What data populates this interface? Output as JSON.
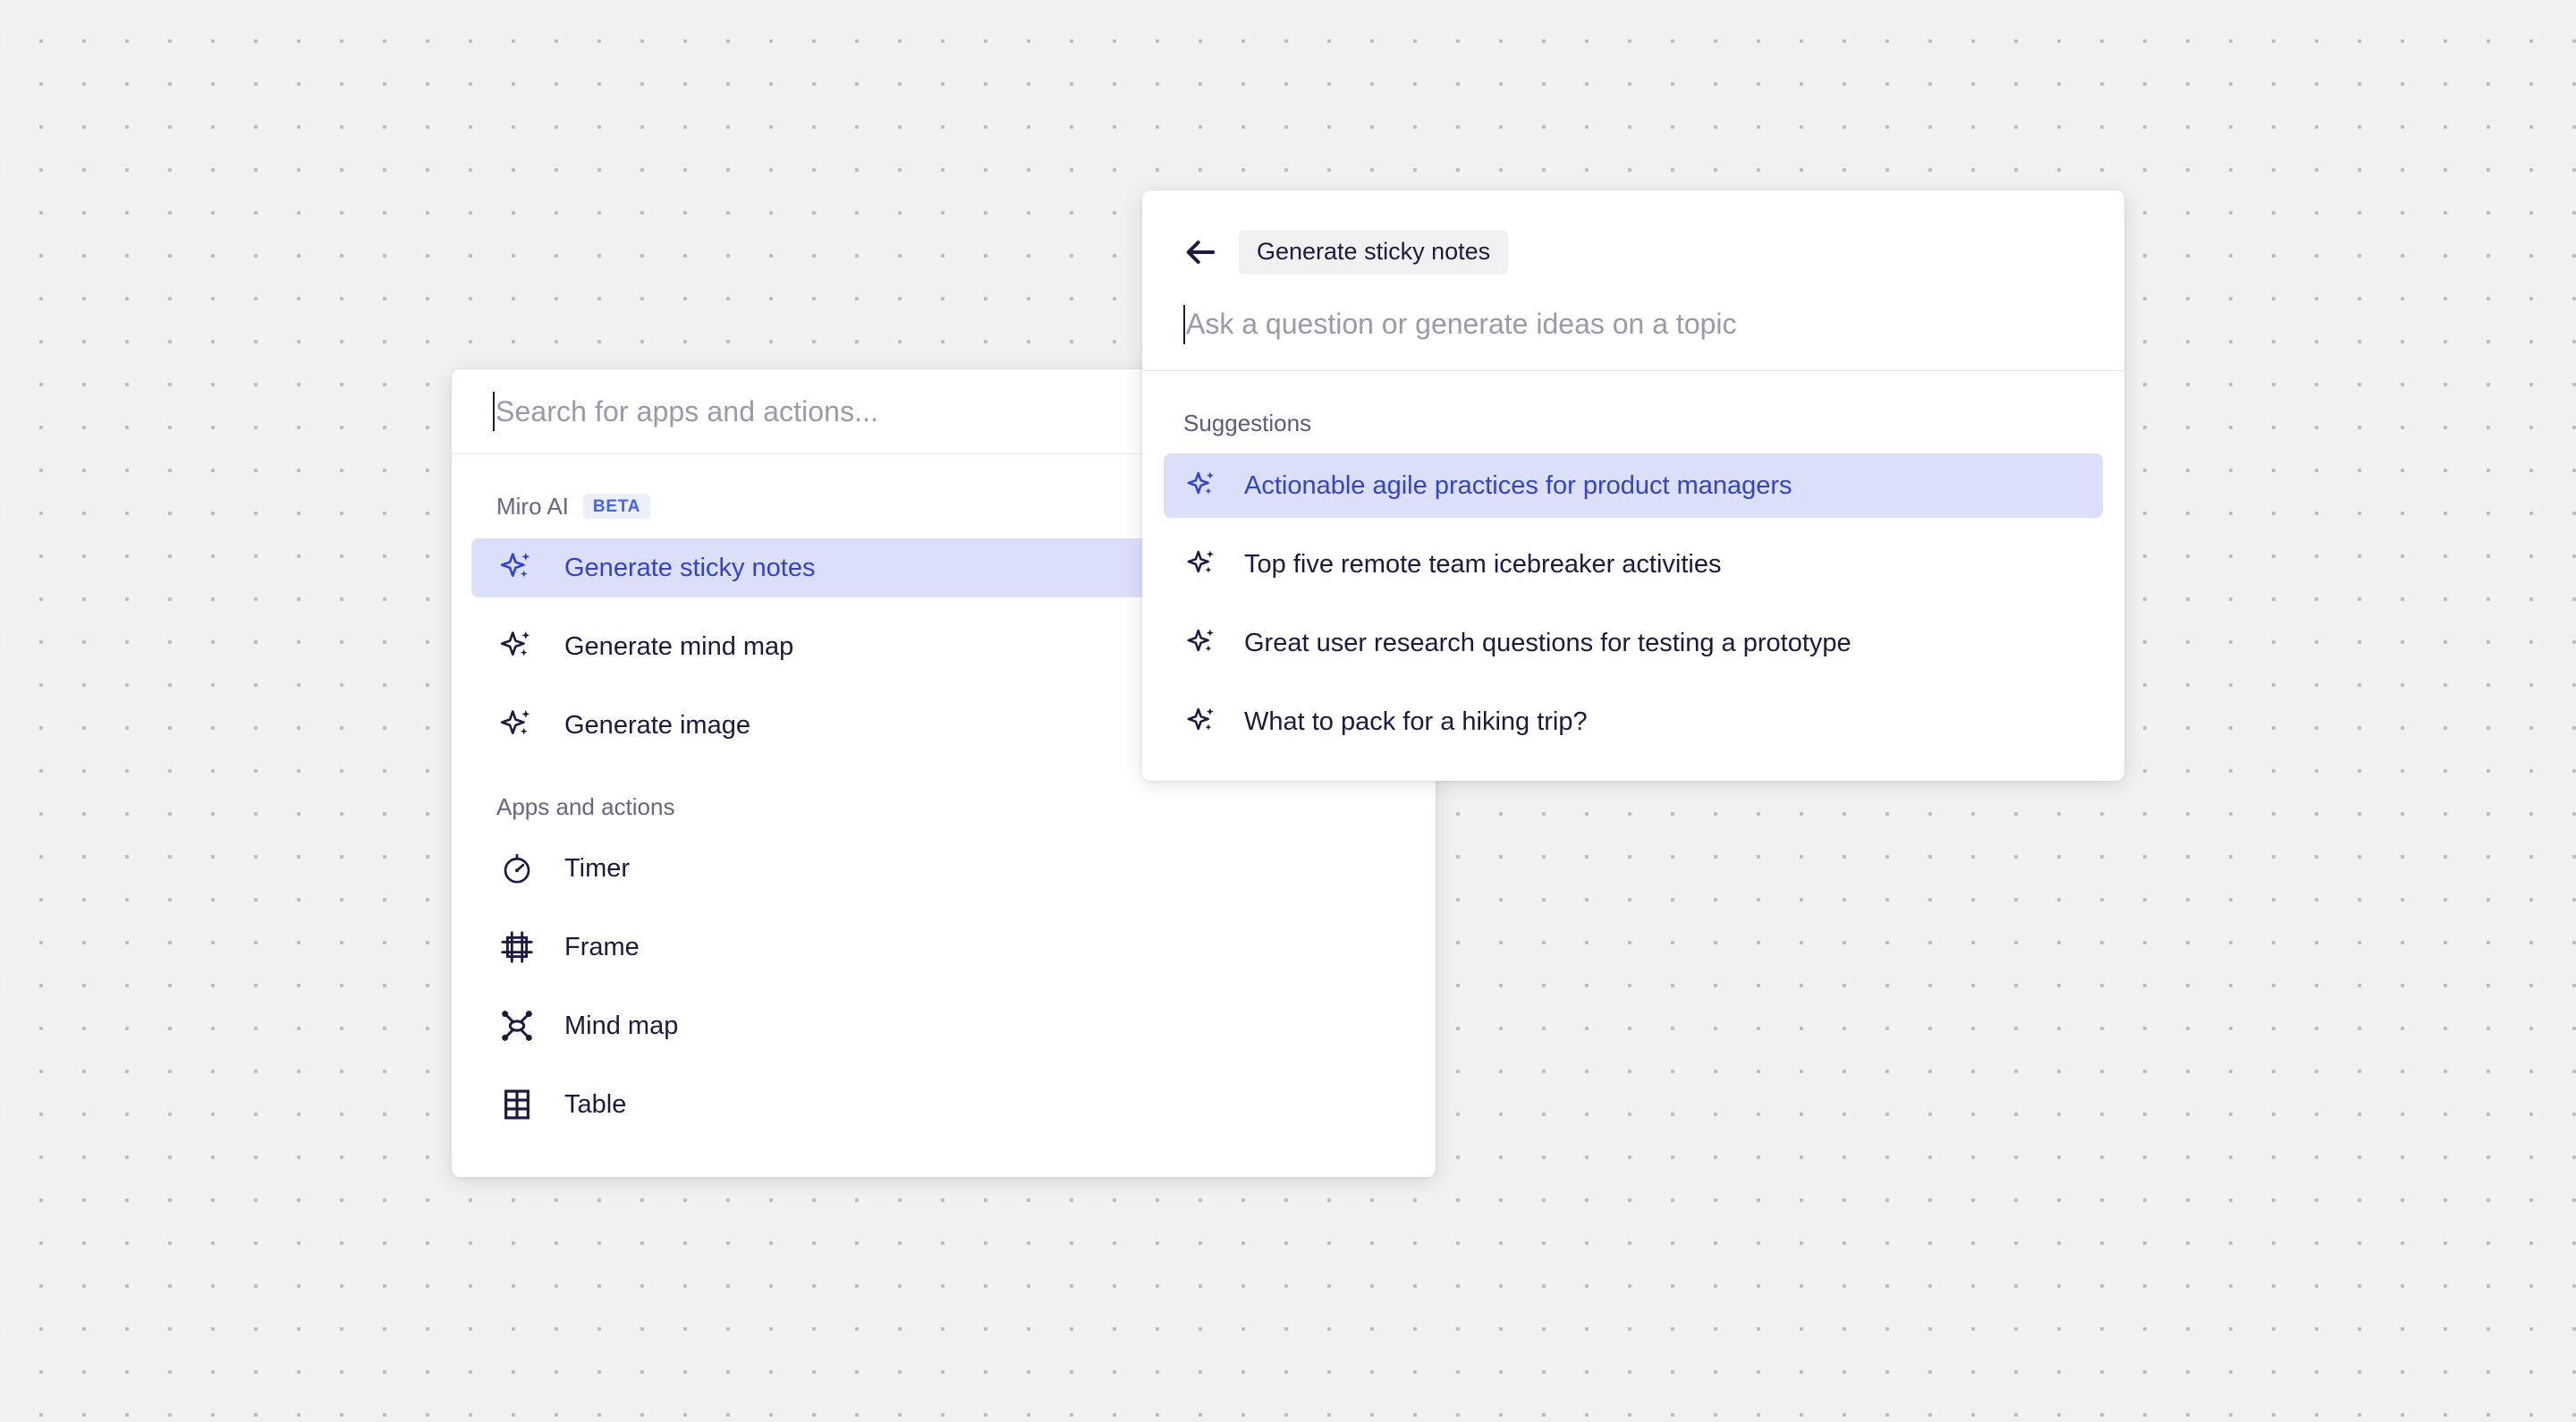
{
  "canvas": {
    "background_color": "#f1f1f1",
    "dot_color": "#bdbdbd"
  },
  "colors": {
    "accent_blue": "#3044cf",
    "badge_blue": "#4262ef",
    "selected_row_bg": "#dcdffa",
    "text_dark": "#1c1a40",
    "text_muted": "#6a6580",
    "placeholder": "#9a9aa8",
    "chip_bg": "#f1f1f1",
    "badge_bg": "#eceffd"
  },
  "apps_panel": {
    "search": {
      "value": "",
      "placeholder": "Search for apps and actions..."
    },
    "groups": [
      {
        "label": "Miro AI",
        "badge": "BETA",
        "items": [
          {
            "label": "Generate sticky notes",
            "icon": "sparkle-icon",
            "selected": true
          },
          {
            "label": "Generate mind map",
            "icon": "sparkle-icon",
            "selected": false
          },
          {
            "label": "Generate image",
            "icon": "sparkle-icon",
            "selected": false
          }
        ]
      },
      {
        "label": "Apps and actions",
        "badge": "",
        "items": [
          {
            "label": "Timer",
            "icon": "timer-icon",
            "selected": false
          },
          {
            "label": "Frame",
            "icon": "frame-icon",
            "selected": false
          },
          {
            "label": "Mind map",
            "icon": "mind-map-icon",
            "selected": false
          },
          {
            "label": "Table",
            "icon": "table-icon",
            "selected": false
          }
        ]
      }
    ]
  },
  "ai_panel": {
    "back_icon": "arrow-left-icon",
    "chip_label": "Generate sticky notes",
    "prompt": {
      "value": "",
      "placeholder": "Ask a question or generate ideas on a topic"
    },
    "suggestions_label": "Suggestions",
    "suggestions": [
      {
        "label": "Actionable agile practices for product managers",
        "icon": "sparkle-icon",
        "selected": true
      },
      {
        "label": "Top five remote team icebreaker activities",
        "icon": "sparkle-icon",
        "selected": false
      },
      {
        "label": "Great user research questions for testing a prototype",
        "icon": "sparkle-icon",
        "selected": false
      },
      {
        "label": "What to pack for a hiking trip?",
        "icon": "sparkle-icon",
        "selected": false
      }
    ]
  }
}
